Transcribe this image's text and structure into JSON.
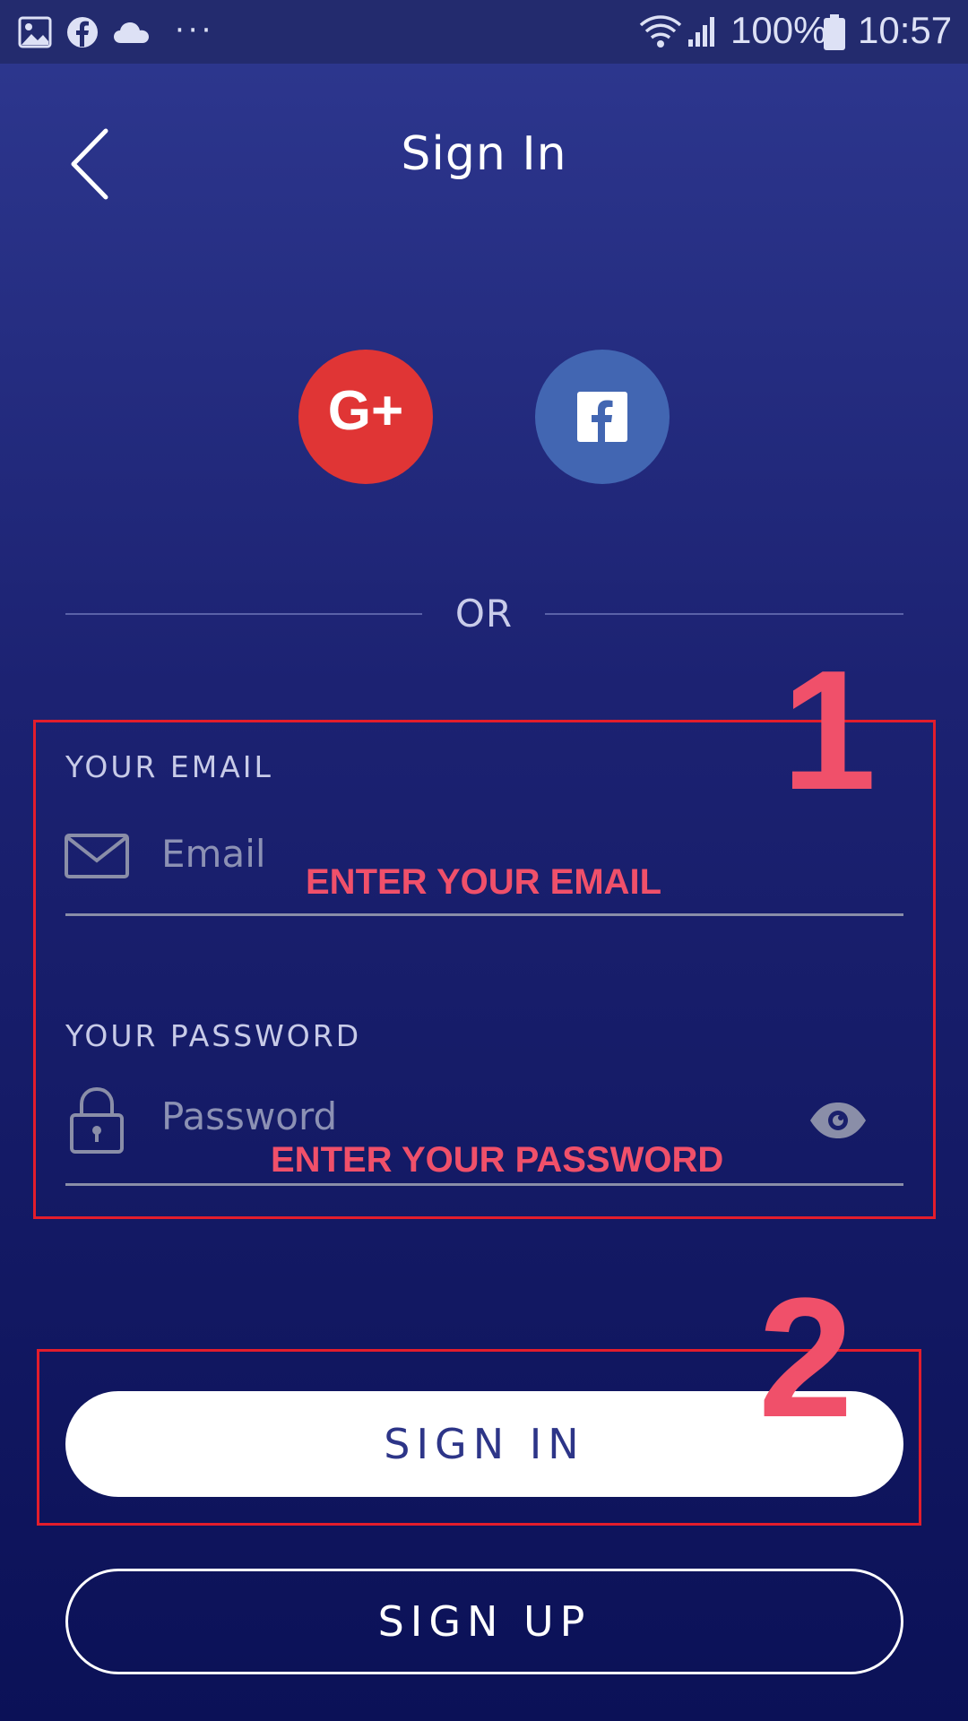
{
  "status_bar": {
    "battery": "100%",
    "time": "10:57",
    "left_icons": [
      "gallery-icon",
      "facebook-notification-icon",
      "cloud-icon",
      "more-dots-icon"
    ],
    "right_icons": [
      "wifi-icon",
      "signal-icon",
      "battery-icon"
    ]
  },
  "header": {
    "title": "Sign In",
    "back_icon": "chevron-left-icon"
  },
  "social": {
    "google_label": "G+",
    "google_color": "#e03535",
    "facebook_color": "#4266b2"
  },
  "divider": {
    "text": "OR"
  },
  "email": {
    "label": "YOUR EMAIL",
    "placeholder": "Email",
    "icon": "envelope-icon",
    "annotation": "ENTER YOUR EMAIL"
  },
  "password": {
    "label": "YOUR PASSWORD",
    "placeholder": "Password",
    "icon": "lock-icon",
    "toggle_icon": "eye-icon",
    "annotation": "ENTER YOUR PASSWORD"
  },
  "annotations": {
    "step1": "1",
    "step2": "2",
    "color": "#f0506a",
    "box_color": "#e31d2c"
  },
  "buttons": {
    "sign_in": "SIGN IN",
    "sign_up": "SIGN UP"
  }
}
